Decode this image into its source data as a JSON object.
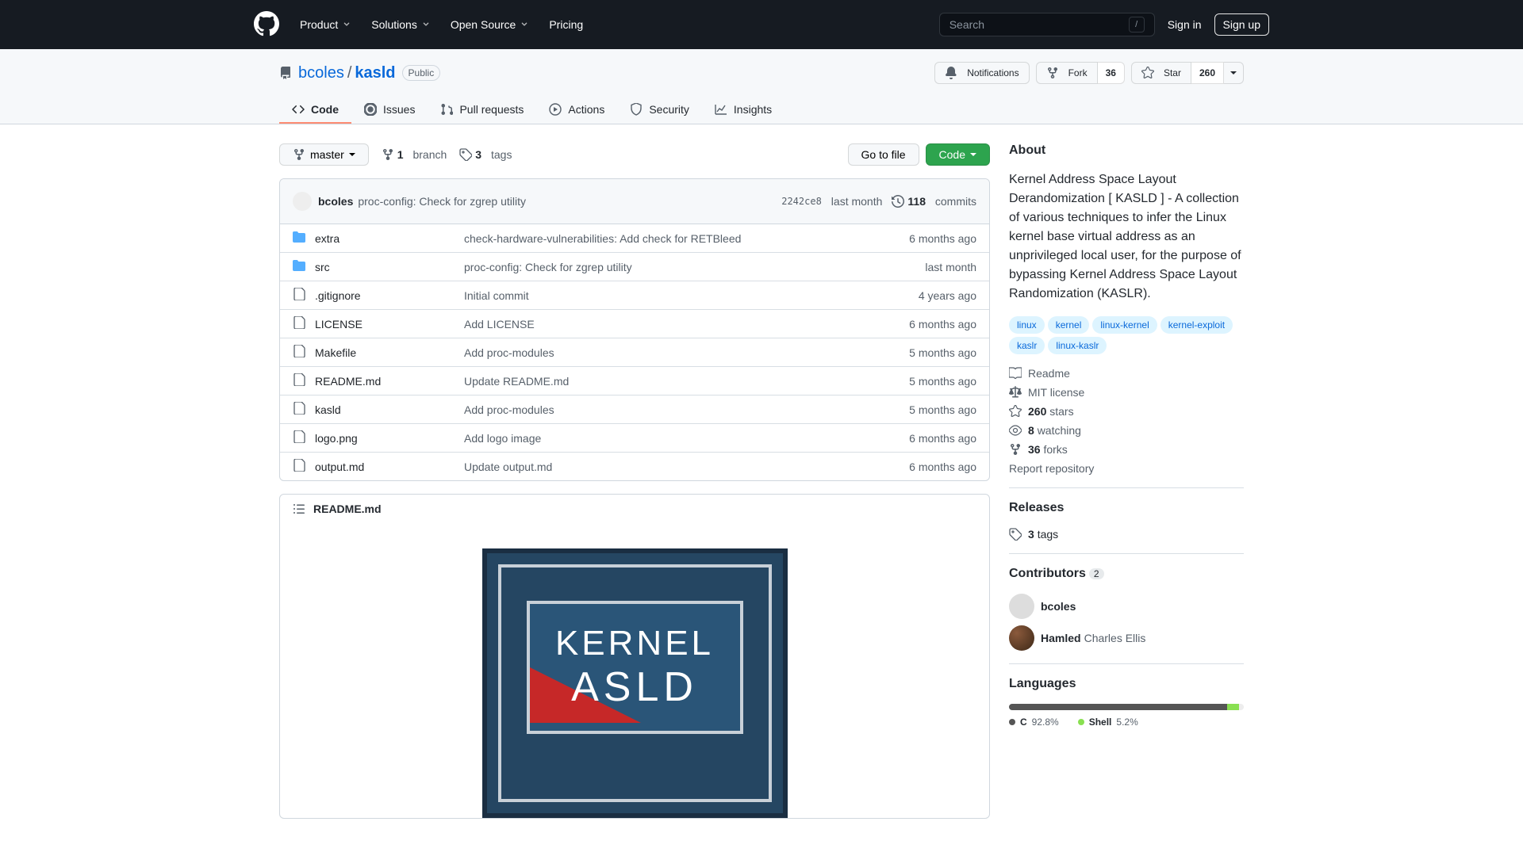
{
  "header": {
    "nav": [
      "Product",
      "Solutions",
      "Open Source",
      "Pricing"
    ],
    "search_placeholder": "Search",
    "slash": "/",
    "signin": "Sign in",
    "signup": "Sign up"
  },
  "repo": {
    "owner": "bcoles",
    "name": "kasld",
    "visibility": "Public",
    "notifications_label": "Notifications",
    "fork_label": "Fork",
    "fork_count": "36",
    "star_label": "Star",
    "star_count": "260"
  },
  "tabs": [
    {
      "label": "Code",
      "icon": "code"
    },
    {
      "label": "Issues",
      "icon": "issues"
    },
    {
      "label": "Pull requests",
      "icon": "pr"
    },
    {
      "label": "Actions",
      "icon": "play"
    },
    {
      "label": "Security",
      "icon": "shield"
    },
    {
      "label": "Insights",
      "icon": "graph"
    }
  ],
  "filenav": {
    "branch": "master",
    "branches_count": "1",
    "branches_label": "branch",
    "tags_count": "3",
    "tags_label": "tags",
    "go_to_file": "Go to file",
    "code_label": "Code"
  },
  "latest_commit": {
    "author": "bcoles",
    "message": "proc-config: Check for zgrep utility",
    "sha": "2242ce8",
    "when": "last month",
    "commits_count": "118",
    "commits_label": "commits"
  },
  "files": [
    {
      "type": "dir",
      "name": "extra",
      "msg": "check-hardware-vulnerabilities: Add check for RETBleed",
      "when": "6 months ago"
    },
    {
      "type": "dir",
      "name": "src",
      "msg": "proc-config: Check for zgrep utility",
      "when": "last month"
    },
    {
      "type": "file",
      "name": ".gitignore",
      "msg": "Initial commit",
      "when": "4 years ago"
    },
    {
      "type": "file",
      "name": "LICENSE",
      "msg": "Add LICENSE",
      "when": "6 months ago"
    },
    {
      "type": "file",
      "name": "Makefile",
      "msg": "Add proc-modules",
      "when": "5 months ago"
    },
    {
      "type": "file",
      "name": "README.md",
      "msg": "Update README.md",
      "when": "5 months ago"
    },
    {
      "type": "file",
      "name": "kasld",
      "msg": "Add proc-modules",
      "when": "5 months ago"
    },
    {
      "type": "file",
      "name": "logo.png",
      "msg": "Add logo image",
      "when": "6 months ago"
    },
    {
      "type": "file",
      "name": "output.md",
      "msg": "Update output.md",
      "when": "6 months ago"
    }
  ],
  "readme": {
    "filename": "README.md",
    "logo_line1": "KERNEL",
    "logo_line2": "ASLD"
  },
  "about": {
    "heading": "About",
    "text": "Kernel Address Space Layout Derandomization [ KASLD ] - A collection of various techniques to infer the Linux kernel base virtual address as an unprivileged local user, for the purpose of bypassing Kernel Address Space Layout Randomization (KASLR).",
    "topics": [
      "linux",
      "kernel",
      "linux-kernel",
      "kernel-exploit",
      "kaslr",
      "linux-kaslr"
    ],
    "readme_link": "Readme",
    "license": "MIT license",
    "stars_count": "260",
    "stars_label": "stars",
    "watching_count": "8",
    "watching_label": "watching",
    "forks_count": "36",
    "forks_label": "forks",
    "report": "Report repository"
  },
  "releases": {
    "heading": "Releases",
    "tags_count": "3",
    "tags_label": "tags"
  },
  "contributors": {
    "heading": "Contributors",
    "count": "2",
    "list": [
      {
        "login": "bcoles",
        "name": ""
      },
      {
        "login": "Hamled",
        "name": "Charles Ellis"
      }
    ]
  },
  "languages": {
    "heading": "Languages",
    "list": [
      {
        "name": "C",
        "pct": "92.8%",
        "color": "#555555"
      },
      {
        "name": "Shell",
        "pct": "5.2%",
        "color": "#89e051"
      }
    ]
  }
}
